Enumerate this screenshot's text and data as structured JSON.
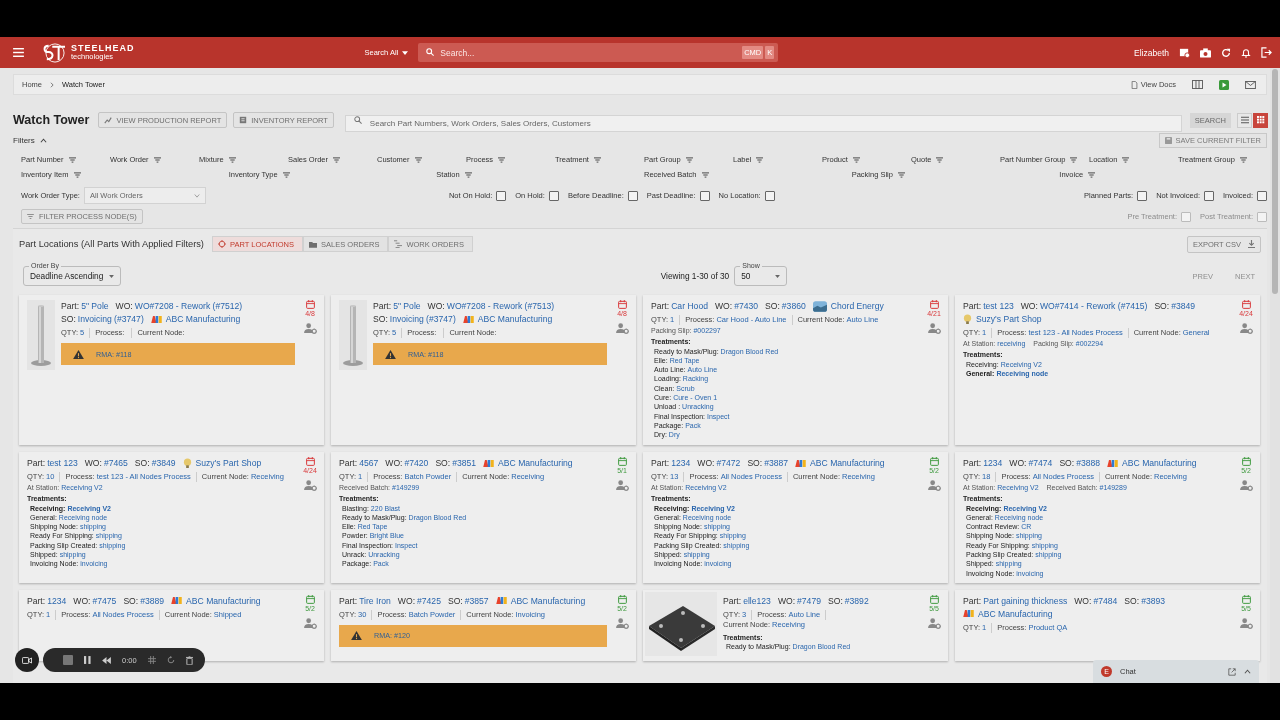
{
  "header": {
    "brand": "STEELHEAD",
    "brand_sub": "technologies",
    "search_scope": "Search All",
    "search_placeholder": "Search...",
    "shortcut": [
      "CMD",
      "K"
    ],
    "user": "Elizabeth"
  },
  "breadcrumbs": [
    "Home",
    "Watch Tower"
  ],
  "docs_link": "View Docs",
  "page": {
    "title": "Watch Tower",
    "buttons": [
      "VIEW PRODUCTION REPORT",
      "INVENTORY REPORT"
    ],
    "search_placeholder": "Search Part Numbers, Work Orders, Sales Orders, Customers",
    "search_button": "SEARCH",
    "views": [
      {
        "kind": "list",
        "selected": false
      },
      {
        "kind": "grid",
        "selected": true
      }
    ]
  },
  "filters": {
    "label": "Filters",
    "expanded": true,
    "save_button": {
      "label": "SAVE CURRENT FILTER",
      "disabled": true
    },
    "columns": [
      "Part Number",
      "Work Order",
      "Mixture",
      "Sales Order",
      "Customer",
      "Process",
      "Treatment",
      "Part Group",
      "Label",
      "Product",
      "Quote",
      "Part Number Group",
      "Location",
      "Treatment Group"
    ],
    "columns_2": [
      "Inventory Item",
      "Inventory Type",
      "Station",
      "Received Batch",
      "Packing Slip",
      "Invoice"
    ],
    "work_order_type": {
      "label": "Work Order Type:",
      "value": "All Work Orders"
    },
    "checks_middle": [
      {
        "label": "Not On Hold:",
        "checked": false
      },
      {
        "label": "On Hold:",
        "checked": false
      },
      {
        "label": "Before Deadline:",
        "checked": false
      },
      {
        "label": "Past Deadline:",
        "checked": false
      },
      {
        "label": "No Location:",
        "checked": false
      }
    ],
    "checks_right": [
      {
        "label": "Planned Parts:",
        "checked": false
      },
      {
        "label": "Not Invoiced:",
        "checked": false
      },
      {
        "label": "Invoiced:",
        "checked": false
      }
    ],
    "process_button": "FILTER PROCESS NODE(S)",
    "treatment_checks": [
      {
        "label": "Pre Treatment:",
        "checked": false,
        "disabled": true
      },
      {
        "label": "Post Treatment:",
        "checked": false,
        "disabled": true
      }
    ]
  },
  "section": {
    "title": "Part Locations (All Parts With Applied Filters)",
    "tabs": [
      {
        "label": "PART LOCATIONS",
        "selected": true
      },
      {
        "label": "SALES ORDERS",
        "selected": false
      },
      {
        "label": "WORK ORDERS",
        "selected": false
      }
    ],
    "export": "EXPORT CSV",
    "order_by": {
      "label": "Order By",
      "value": "Deadline Ascending"
    },
    "viewing": "Viewing 1-30 of 30",
    "show": {
      "label": "Show",
      "value": "50"
    },
    "pager": [
      {
        "label": "PREV",
        "disabled": true
      },
      {
        "label": "NEXT",
        "disabled": true
      }
    ]
  },
  "cards": [
    {
      "head": [
        {
          "label": "Part:",
          "value": "5\" Pole"
        },
        {
          "label": "WO:",
          "value": "WO#7208 - Rework (#7512)"
        },
        {
          "label": "SO:",
          "value": "Invoicing (#3747)"
        },
        {
          "kind": "customer",
          "logo": {
            "kind": "multicolor"
          },
          "value": "ABC Manufacturing"
        }
      ],
      "due": "4/8",
      "overdue": true,
      "image": {
        "kind": "picture"
      },
      "stats": [
        {
          "label": "QTY:",
          "value": "5"
        },
        {
          "label": "Process:"
        },
        {
          "label": "Current Node:"
        }
      ],
      "rma": "RMA: #118"
    },
    {
      "head": [
        {
          "label": "Part:",
          "value": "5\" Pole"
        },
        {
          "label": "WO:",
          "value": "WO#7208 - Rework (#7513)"
        },
        {
          "label": "SO:",
          "value": "Invoicing (#3747)"
        },
        {
          "kind": "customer",
          "logo": {
            "kind": "multicolor"
          },
          "value": "ABC Manufacturing"
        }
      ],
      "due": "4/8",
      "overdue": true,
      "image": {
        "kind": "picture"
      },
      "stats": [
        {
          "label": "QTY:",
          "value": "5"
        },
        {
          "label": "Process:"
        },
        {
          "label": "Current Node:"
        }
      ],
      "rma": "RMA: #118"
    },
    {
      "head": [
        {
          "label": "Part:",
          "value": "Car Hood"
        },
        {
          "label": "WO:",
          "value": "#7430"
        },
        {
          "label": "SO:",
          "value": "#3860"
        },
        {
          "kind": "customer",
          "logo": {
            "kind": "landscape"
          },
          "value": "Chord Energy"
        }
      ],
      "due": "4/21",
      "overdue": true,
      "stats": [
        {
          "label": "QTY:",
          "value": "1"
        },
        {
          "label": "Process:",
          "value": "Car Hood - Auto Line"
        },
        {
          "label": "Current Node:",
          "value": "Auto Line"
        }
      ],
      "details": [
        {
          "label": "Packing Slip:",
          "value": "#002297"
        }
      ],
      "treatments_label": "Treatments:",
      "treatments": [
        {
          "label": "Ready to Mask/Plug:",
          "value": "Dragon Blood Red",
          "bold": false
        },
        {
          "label": "Elle:",
          "value": "Red Tape",
          "bold": false
        },
        {
          "label": "Auto Line:",
          "value": "Auto Line",
          "bold": false
        },
        {
          "label": "Loading:",
          "value": "Racking",
          "bold": false
        },
        {
          "label": "Clean:",
          "value": "Scrub",
          "bold": false
        },
        {
          "label": "Cure:",
          "value": "Cure - Oven 1",
          "bold": false
        },
        {
          "label": "Unload :",
          "value": "Unracking",
          "bold": false
        },
        {
          "label": "Final Inspection:",
          "value": "Inspect",
          "bold": false
        },
        {
          "label": "Package:",
          "value": "Pack",
          "bold": false
        },
        {
          "label": "Dry:",
          "value": "Dry",
          "bold": false
        }
      ]
    },
    {
      "head": [
        {
          "label": "Part:",
          "value": "test 123"
        },
        {
          "label": "WO:",
          "value": "WO#7414 - Rework (#7415)"
        },
        {
          "label": "SO:",
          "value": "#3849"
        },
        {
          "kind": "customer",
          "logo": {
            "kind": "bulb"
          },
          "value": "Suzy's Part Shop"
        }
      ],
      "due": "4/24",
      "overdue": true,
      "stats": [
        {
          "label": "QTY:",
          "value": "1"
        },
        {
          "label": "Process:",
          "value": "test 123 - All Nodes Process"
        },
        {
          "label": "Current Node:",
          "value": "General"
        }
      ],
      "details": [
        {
          "label": "At Station:",
          "value": "receiving"
        },
        {
          "label": "Packing Slip:",
          "value": "#002294"
        }
      ],
      "treatments_label": "Treatments:",
      "treatments": [
        {
          "label": "Receiving:",
          "value": "Receiving V2",
          "bold": false
        },
        {
          "label": "General:",
          "value": "Receiving node",
          "bold": true
        }
      ]
    },
    {
      "head": [
        {
          "label": "Part:",
          "value": "test 123"
        },
        {
          "label": "WO:",
          "value": "#7465"
        },
        {
          "label": "SO:",
          "value": "#3849"
        },
        {
          "kind": "customer",
          "logo": {
            "kind": "bulb"
          },
          "value": "Suzy's Part Shop"
        }
      ],
      "due": "4/24",
      "overdue": true,
      "stats": [
        {
          "label": "QTY:",
          "value": "10"
        },
        {
          "label": "Process:",
          "value": "test 123 - All Nodes Process"
        },
        {
          "label": "Current Node:",
          "value": "Receiving"
        }
      ],
      "details": [
        {
          "label": "At Station:",
          "value": "Receiving V2"
        }
      ],
      "treatments_label": "Treatments:",
      "treatments": [
        {
          "label": "Receiving:",
          "value": "Receiving V2",
          "bold": true
        },
        {
          "label": "General:",
          "value": "Receiving node",
          "bold": false
        },
        {
          "label": "Shipping Node:",
          "value": "shipping",
          "bold": false
        },
        {
          "label": "Ready For Shipping:",
          "value": "shipping",
          "bold": false
        },
        {
          "label": "Packing Slip Created:",
          "value": "shipping",
          "bold": false
        },
        {
          "label": "Shipped:",
          "value": "shipping",
          "bold": false
        },
        {
          "label": "Invoicing Node:",
          "value": "invoicing",
          "bold": false
        }
      ]
    },
    {
      "head": [
        {
          "label": "Part:",
          "value": "4567"
        },
        {
          "label": "WO:",
          "value": "#7420"
        },
        {
          "label": "SO:",
          "value": "#3851"
        },
        {
          "kind": "customer",
          "logo": {
            "kind": "multicolor"
          },
          "value": "ABC Manufacturing"
        }
      ],
      "due": "5/1",
      "overdue": false,
      "stats": [
        {
          "label": "QTY:",
          "value": "1"
        },
        {
          "label": "Process:",
          "value": "Batch Powder"
        },
        {
          "label": "Current Node:",
          "value": "Receiving"
        }
      ],
      "details": [
        {
          "label": "Received Batch:",
          "value": "#149299"
        }
      ],
      "treatments_label": "Treatments:",
      "treatments": [
        {
          "label": "Blasting:",
          "value": "220 Blast",
          "bold": false
        },
        {
          "label": "Ready to Mask/Plug:",
          "value": "Dragon Blood Red",
          "bold": false
        },
        {
          "label": "Elle:",
          "value": "Red Tape",
          "bold": false
        },
        {
          "label": "Powder:",
          "value": "Bright Blue",
          "bold": false
        },
        {
          "label": "Final Inspection:",
          "value": "Inspect",
          "bold": false
        },
        {
          "label": "Unrack:",
          "value": "Unracking",
          "bold": false
        },
        {
          "label": "Package:",
          "value": "Pack",
          "bold": false
        }
      ]
    },
    {
      "head": [
        {
          "label": "Part:",
          "value": "1234"
        },
        {
          "label": "WO:",
          "value": "#7472"
        },
        {
          "label": "SO:",
          "value": "#3887"
        },
        {
          "kind": "customer",
          "logo": {
            "kind": "multicolor"
          },
          "value": "ABC Manufacturing"
        }
      ],
      "due": "5/2",
      "overdue": false,
      "stats": [
        {
          "label": "QTY:",
          "value": "13"
        },
        {
          "label": "Process:",
          "value": "All Nodes Process"
        },
        {
          "label": "Current Node:",
          "value": "Receiving"
        }
      ],
      "details": [
        {
          "label": "At Station:",
          "value": "Receiving V2"
        }
      ],
      "treatments_label": "Treatments:",
      "treatments": [
        {
          "label": "Receiving:",
          "value": "Receiving V2",
          "bold": true
        },
        {
          "label": "General:",
          "value": "Receiving node",
          "bold": false
        },
        {
          "label": "Shipping Node:",
          "value": "shipping",
          "bold": false
        },
        {
          "label": "Ready For Shipping:",
          "value": "shipping",
          "bold": false
        },
        {
          "label": "Packing Slip Created:",
          "value": "shipping",
          "bold": false
        },
        {
          "label": "Shipped:",
          "value": "shipping",
          "bold": false
        },
        {
          "label": "Invoicing Node:",
          "value": "invoicing",
          "bold": false
        }
      ]
    },
    {
      "head": [
        {
          "label": "Part:",
          "value": "1234"
        },
        {
          "label": "WO:",
          "value": "#7474"
        },
        {
          "label": "SO:",
          "value": "#3888"
        },
        {
          "kind": "customer",
          "logo": {
            "kind": "multicolor"
          },
          "value": "ABC Manufacturing"
        }
      ],
      "due": "5/2",
      "overdue": false,
      "stats": [
        {
          "label": "QTY:",
          "value": "18"
        },
        {
          "label": "Process:",
          "value": "All Nodes Process"
        },
        {
          "label": "Current Node:",
          "value": "Receiving"
        }
      ],
      "details": [
        {
          "label": "At Station:",
          "value": "Receiving V2"
        },
        {
          "label": "Received Batch:",
          "value": "#149289"
        }
      ],
      "treatments_label": "Treatments:",
      "treatments": [
        {
          "label": "Receiving:",
          "value": "Receiving V2",
          "bold": true
        },
        {
          "label": "General:",
          "value": "Receiving node",
          "bold": false
        },
        {
          "label": "Contract Review:",
          "value": "CR",
          "bold": false
        },
        {
          "label": "Shipping Node:",
          "value": "shipping",
          "bold": false
        },
        {
          "label": "Ready For Shipping:",
          "value": "shipping",
          "bold": false
        },
        {
          "label": "Packing Slip Created:",
          "value": "shipping",
          "bold": false
        },
        {
          "label": "Shipped:",
          "value": "shipping",
          "bold": false
        },
        {
          "label": "Invoicing Node:",
          "value": "invoicing",
          "bold": false
        }
      ]
    },
    {
      "head": [
        {
          "label": "Part:",
          "value": "1234"
        },
        {
          "label": "WO:",
          "value": "#7475"
        },
        {
          "label": "SO:",
          "value": "#3889"
        },
        {
          "kind": "customer",
          "logo": {
            "kind": "multicolor"
          },
          "value": "ABC Manufacturing"
        }
      ],
      "due": "5/2",
      "overdue": false,
      "stats": [
        {
          "label": "QTY:",
          "value": "1"
        },
        {
          "label": "Process:",
          "value": "All Nodes Process"
        },
        {
          "label": "Current Node:",
          "value": "Shipped"
        }
      ]
    },
    {
      "head": [
        {
          "label": "Part:",
          "value": "Tire Iron"
        },
        {
          "label": "WO:",
          "value": "#7425"
        },
        {
          "label": "SO:",
          "value": "#3857"
        },
        {
          "kind": "customer",
          "logo": {
            "kind": "multicolor"
          },
          "value": "ABC Manufacturing"
        }
      ],
      "due": "5/2",
      "overdue": false,
      "stats": [
        {
          "label": "QTY:",
          "value": "30"
        },
        {
          "label": "Process:",
          "value": "Batch Powder"
        },
        {
          "label": "Current Node:",
          "value": "Invoicing"
        }
      ],
      "rma": "RMA: #120"
    },
    {
      "head": [
        {
          "label": "Part:",
          "value": "elle123"
        },
        {
          "label": "WO:",
          "value": "#7479"
        },
        {
          "label": "SO:",
          "value": "#3892"
        }
      ],
      "due": "5/5",
      "overdue": false,
      "image": {
        "kind": "picture"
      },
      "stats": [
        {
          "label": "QTY:",
          "value": "3"
        },
        {
          "label": "Process:",
          "value": "Auto Line"
        },
        {
          "label": "Current Node:",
          "value": "Receiving"
        }
      ],
      "treatments_label": "Treatments:",
      "treatments": [
        {
          "label": "Ready to Mask/Plug:",
          "value": "Dragon Blood Red",
          "bold": false
        }
      ]
    },
    {
      "head": [
        {
          "label": "Part:",
          "value": "Part gaining thickness"
        },
        {
          "label": "WO:",
          "value": "#7484"
        },
        {
          "label": "SO:",
          "value": "#3893"
        },
        {
          "kind": "customer",
          "logo": {
            "kind": "multicolor"
          },
          "value": "ABC Manufacturing"
        }
      ],
      "due": "5/5",
      "overdue": false,
      "stats": [
        {
          "label": "QTY:",
          "value": "1"
        },
        {
          "label": "Process:",
          "value": "Product QA"
        }
      ]
    }
  ],
  "recorder": {
    "time": "0:00"
  },
  "chat": {
    "initial": "E",
    "label": "Chat"
  }
}
